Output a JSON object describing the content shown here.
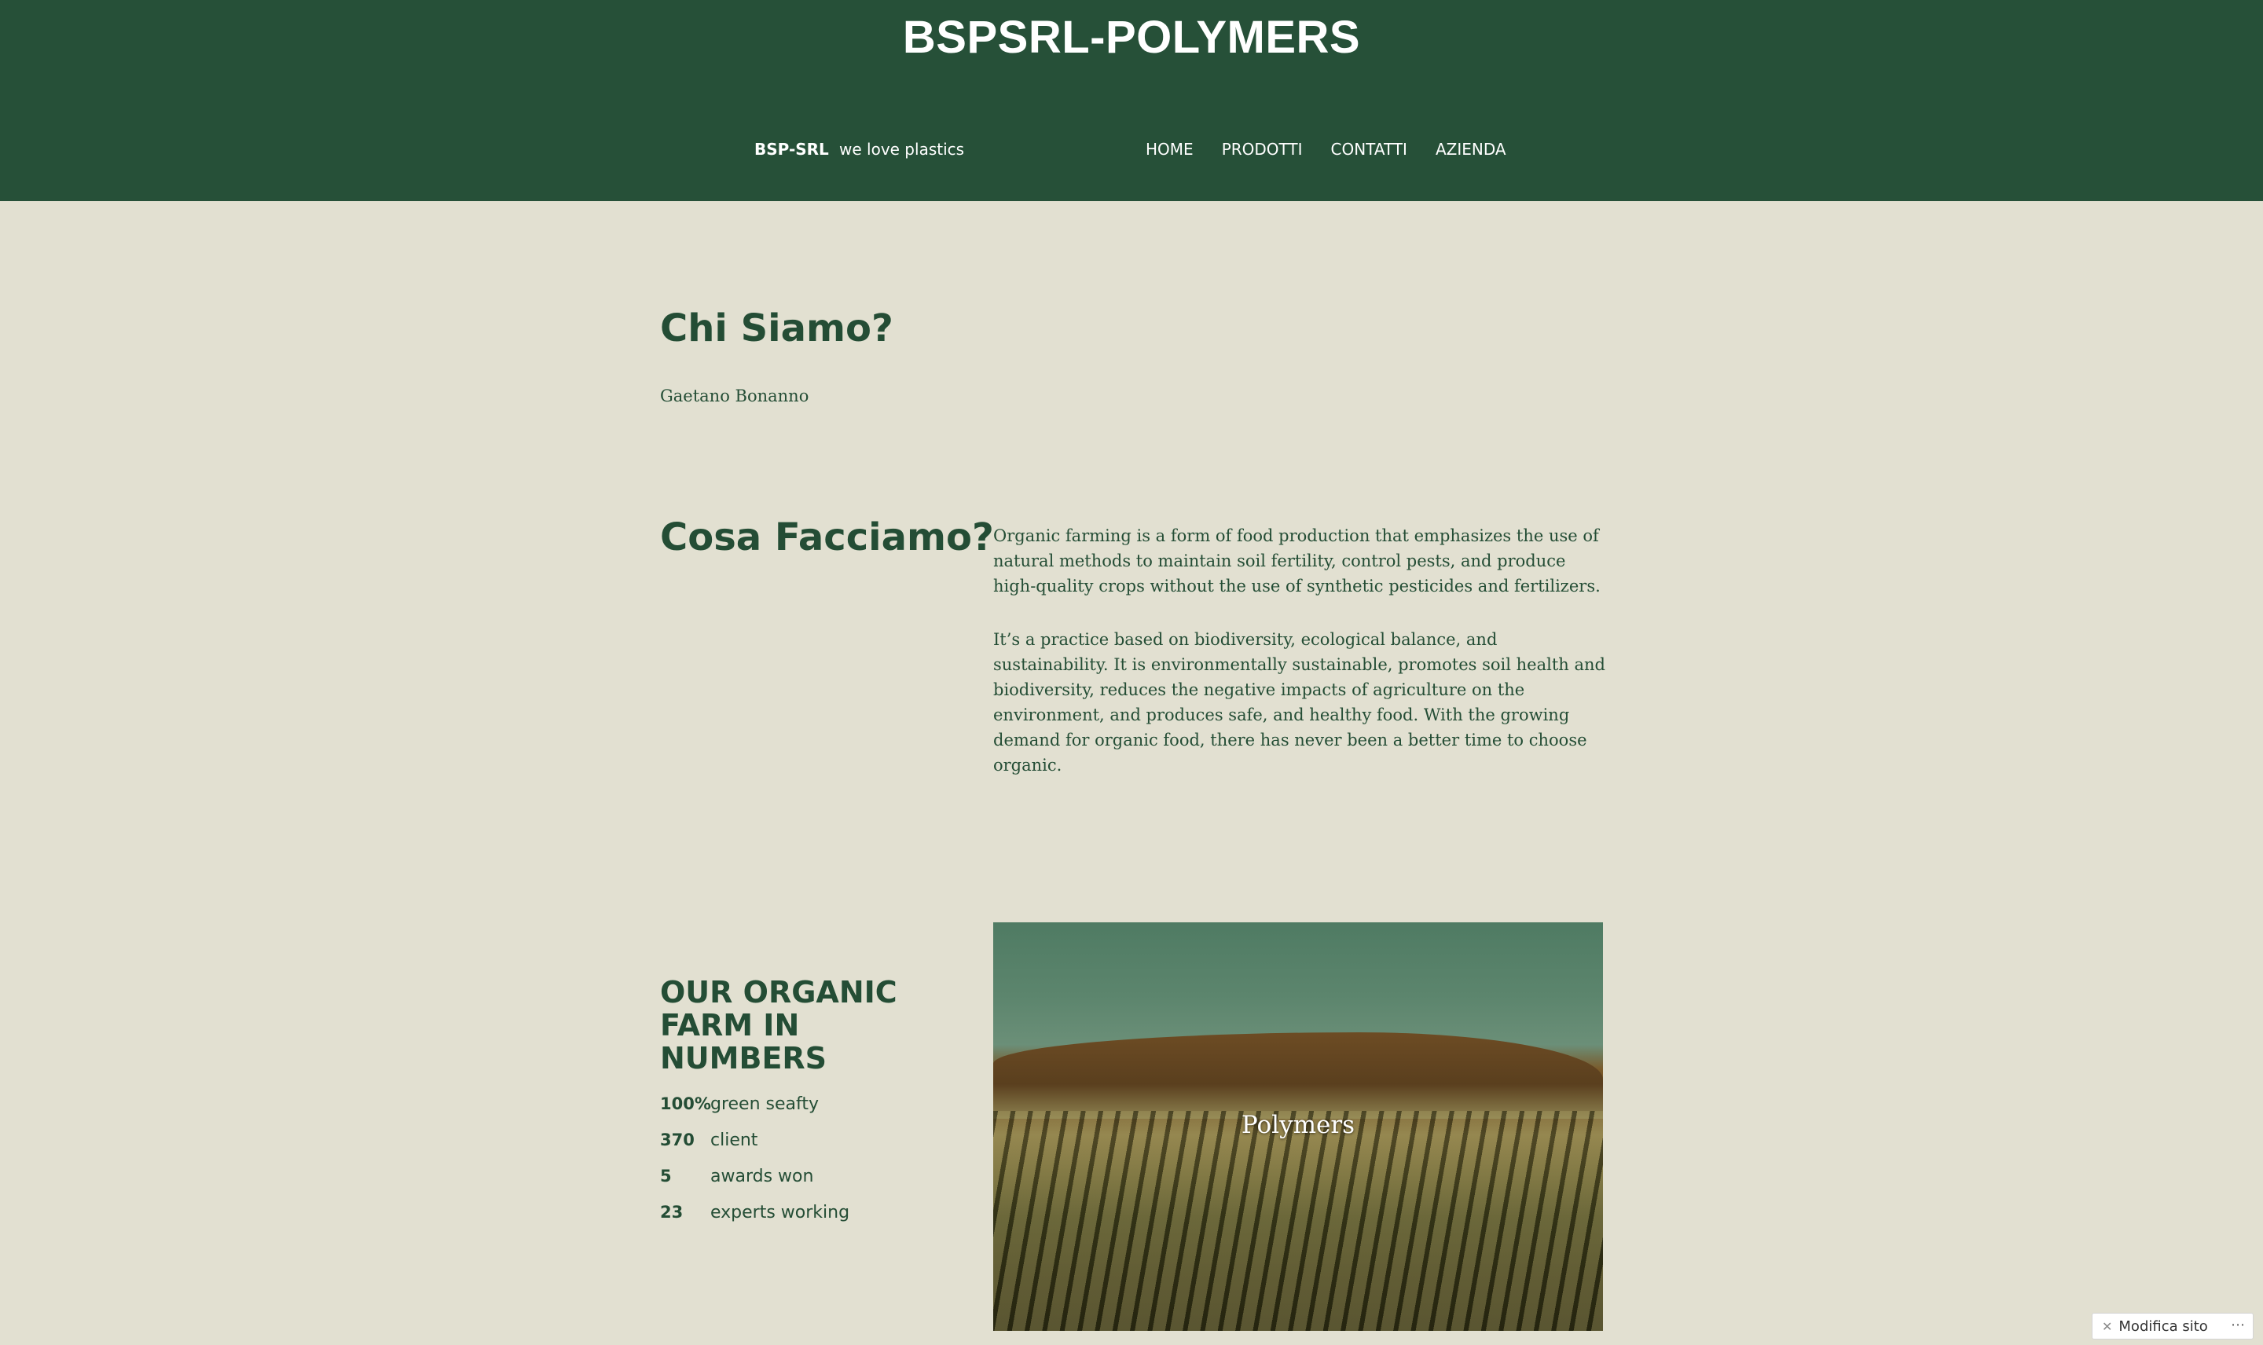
{
  "header": {
    "site_title": "BSPSRL-POLYMERS",
    "brand": "BSP-SRL",
    "tagline": "we love plastics",
    "nav": [
      "HOME",
      "PRODOTTI",
      "CONTATTI",
      "AZIENDA"
    ]
  },
  "about": {
    "heading": "Chi Siamo?",
    "author": "Gaetano Bonanno"
  },
  "what": {
    "heading": "Cosa Facciamo?",
    "paragraph_1": "Organic farming is a form of food production that emphasizes the use of natural methods to maintain soil fertility, control pests, and produce high-quality crops without the use of synthetic pesticides and fertilizers.",
    "paragraph_2": "It’s a practice based on biodiversity, ecological balance, and sustainability. It is environmentally sustainable, promotes soil health and biodiversity, reduces the negative impacts of agriculture on the environment, and produces safe, and healthy food. With the growing demand for organic food, there has never been a better time to choose organic."
  },
  "numbers": {
    "heading": "OUR ORGANIC FARM IN NUMBERS",
    "stats": [
      {
        "value": "100%",
        "label": "green seafty"
      },
      {
        "value": "370",
        "label": "client"
      },
      {
        "value": "5",
        "label": "awards won"
      },
      {
        "value": "23",
        "label": "experts working"
      }
    ]
  },
  "image": {
    "caption": "Polymers"
  },
  "edit_badge": {
    "label": "Modifica sito",
    "icon": "wrench-icon",
    "menu_icon": "more-dots-icon"
  },
  "colors": {
    "header_bg": "#265038",
    "page_bg": "#e2e0d1",
    "text": "#244d35"
  }
}
